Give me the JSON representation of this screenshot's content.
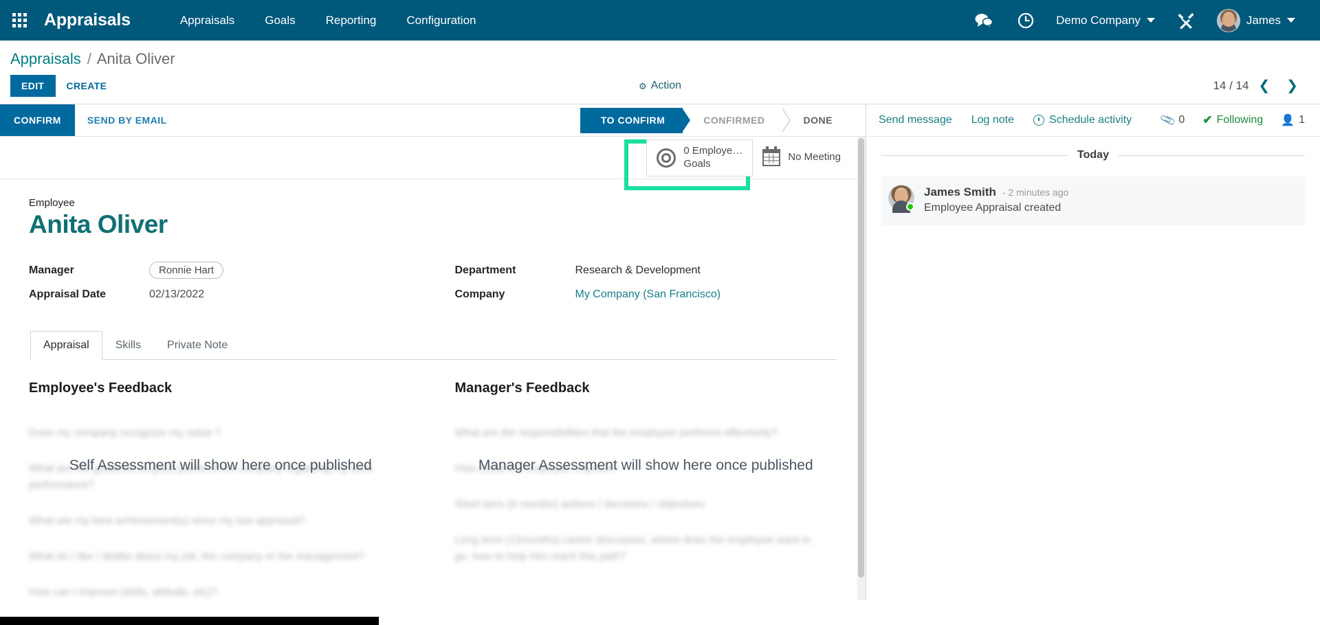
{
  "navbar": {
    "apps_icon": "apps-grid-icon",
    "brand": "Appraisals",
    "menu": [
      {
        "label": "Appraisals"
      },
      {
        "label": "Goals"
      },
      {
        "label": "Reporting"
      },
      {
        "label": "Configuration"
      }
    ],
    "messages_icon": "chat-bubbles-icon",
    "activities_icon": "clock-icon",
    "company": "Demo Company",
    "developer_icon": "tools-wrench-icon",
    "user": "James"
  },
  "breadcrumb": {
    "root": "Appraisals",
    "separator": "/",
    "current": "Anita Oliver"
  },
  "control_panel": {
    "edit_label": "EDIT",
    "create_label": "CREATE",
    "action_label": "Action",
    "action_icon": "gear-icon",
    "pager_value": "14 / 14",
    "pager_prev_icon": "chevron-left-icon",
    "pager_next_icon": "chevron-right-icon"
  },
  "statusbar": {
    "confirm_label": "CONFIRM",
    "send_by_email_label": "SEND BY EMAIL",
    "stages": [
      {
        "label": "TO CONFIRM",
        "active": true
      },
      {
        "label": "CONFIRMED",
        "active": false
      },
      {
        "label": "DONE",
        "active": false
      }
    ]
  },
  "smart_buttons": [
    {
      "icon": "target-bullseye-icon",
      "line1": "0 Employe…",
      "line2": "Goals",
      "highlighted": true
    },
    {
      "icon": "calendar-icon",
      "line1": "No Meeting",
      "line2": "",
      "highlighted": false
    }
  ],
  "highlight_color": "#19dfa0",
  "record": {
    "employee_label": "Employee",
    "employee_name": "Anita Oliver",
    "fields_left": [
      {
        "label": "Manager",
        "value": "Ronnie Hart",
        "style": "tag"
      },
      {
        "label": "Appraisal Date",
        "value": "02/13/2022",
        "style": "text"
      }
    ],
    "fields_right": [
      {
        "label": "Department",
        "value": "Research & Development",
        "style": "dark"
      },
      {
        "label": "Company",
        "value": "My Company (San Francisco)",
        "style": "link"
      }
    ]
  },
  "notebook": {
    "tabs": [
      {
        "label": "Appraisal",
        "active": true
      },
      {
        "label": "Skills",
        "active": false
      },
      {
        "label": "Private Note",
        "active": false
      }
    ],
    "employee_feedback": {
      "title": "Employee's Feedback",
      "overlay": "Self Assessment will show here once published",
      "ghost_lines": [
        "Does my company recognize my value ?",
        "What are the good/not so good points of the company regarding my work performance?",
        "What are my best achievement(s) since my last appraisal?",
        "What do I like / dislike about my job, the company or the management?",
        "How can I improve (skills, attitude, etc)?"
      ]
    },
    "manager_feedback": {
      "title": "Manager's Feedback",
      "overlay": "Manager Assessment will show here once published",
      "ghost_lines": [
        "What are the responsibilities that the employee performs effectively?",
        "How could the employee improve?",
        "Short term (6 months) actions / decisions / objectives",
        "Long term (12months) career discussion, where does the employee want to go, how to help him reach this path?"
      ]
    }
  },
  "chatter": {
    "send_message_label": "Send message",
    "log_note_label": "Log note",
    "schedule_activity_label": "Schedule activity",
    "schedule_activity_icon": "clock-icon",
    "attachment_icon": "paperclip-icon",
    "attachment_count": "0",
    "following_icon": "check-icon",
    "following_label": "Following",
    "followers_icon": "person-icon",
    "followers_count": "1",
    "date_separator": "Today",
    "messages": [
      {
        "author": "James Smith",
        "time": "- 2 minutes ago",
        "text": "Employee Appraisal created",
        "avatar": "user-avatar",
        "online": true
      }
    ]
  }
}
